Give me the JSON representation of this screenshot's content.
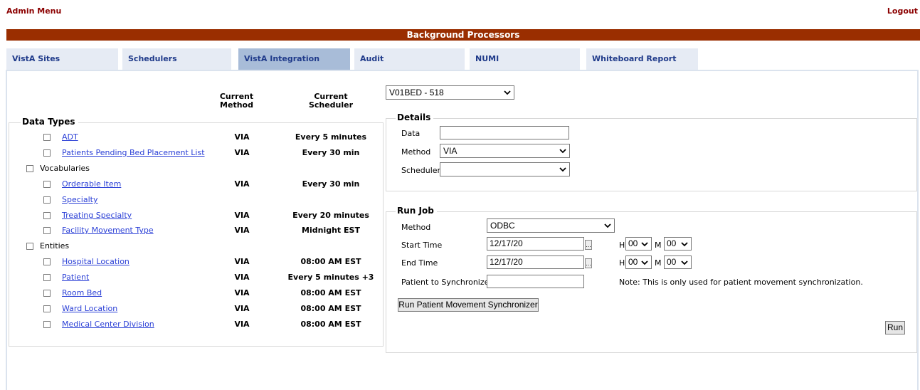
{
  "header": {
    "admin_menu": "Admin Menu",
    "logout": "Logout",
    "title": "Background Processors"
  },
  "tabs": [
    {
      "label": "VistA Sites",
      "active": false
    },
    {
      "label": "Schedulers",
      "active": false
    },
    {
      "label": "VistA Integration",
      "active": true
    },
    {
      "label": "Audit",
      "active": false
    },
    {
      "label": "NUMI",
      "active": false
    },
    {
      "label": "Whiteboard Report",
      "active": false
    }
  ],
  "left": {
    "col_method": "Current\nMethod",
    "col_scheduler": "Current\nScheduler",
    "legend": "Data Types",
    "rows": [
      {
        "label": "ADT",
        "link": true,
        "indent": true,
        "method": "VIA",
        "scheduler": "Every 5 minutes"
      },
      {
        "label": "Patients Pending Bed Placement List",
        "link": true,
        "indent": true,
        "method": "VIA",
        "scheduler": "Every 30 min"
      },
      {
        "label": "Vocabularies",
        "link": false,
        "indent": false,
        "method": "",
        "scheduler": ""
      },
      {
        "label": "Orderable Item",
        "link": true,
        "indent": true,
        "method": "VIA",
        "scheduler": "Every 30 min"
      },
      {
        "label": "Specialty",
        "link": true,
        "indent": true,
        "method": "",
        "scheduler": ""
      },
      {
        "label": "Treating Specialty",
        "link": true,
        "indent": true,
        "method": "VIA",
        "scheduler": "Every 20 minutes"
      },
      {
        "label": "Facility Movement Type",
        "link": true,
        "indent": true,
        "method": "VIA",
        "scheduler": "Midnight EST"
      },
      {
        "label": "Entities",
        "link": false,
        "indent": false,
        "method": "",
        "scheduler": ""
      },
      {
        "label": "Hospital Location",
        "link": true,
        "indent": true,
        "method": "VIA",
        "scheduler": "08:00 AM EST"
      },
      {
        "label": "Patient",
        "link": true,
        "indent": true,
        "method": "VIA",
        "scheduler": "Every 5 minutes +3"
      },
      {
        "label": "Room Bed",
        "link": true,
        "indent": true,
        "method": "VIA",
        "scheduler": "08:00 AM EST"
      },
      {
        "label": "Ward Location",
        "link": true,
        "indent": true,
        "method": "VIA",
        "scheduler": "08:00 AM EST"
      },
      {
        "label": "Medical Center Division",
        "link": true,
        "indent": true,
        "method": "VIA",
        "scheduler": "08:00 AM EST"
      }
    ]
  },
  "site_select": {
    "value": "V01BED - 518"
  },
  "details": {
    "legend": "Details",
    "data_label": "Data",
    "data_value": "",
    "method_label": "Method",
    "method_value": "VIA",
    "scheduler_label": "Scheduler",
    "scheduler_value": ""
  },
  "run_job": {
    "legend": "Run Job",
    "method_label": "Method",
    "method_value": "ODBC",
    "start_label": "Start Time",
    "start_value": "12/17/20",
    "end_label": "End Time",
    "end_value": "12/17/20",
    "h_label": "H",
    "m_label": "M",
    "start_h": "00",
    "start_m": "00",
    "end_h": "00",
    "end_m": "00",
    "patient_label": "Patient to Synchronize",
    "patient_value": "",
    "note": "Note: This is only used for patient movement synchronization.",
    "sync_button": "Run Patient Movement Synchronizer",
    "run_button": "Run",
    "picker_glyph": "..."
  },
  "icons": {
    "dropdown": "chevron-down-icon",
    "date_picker": "ellipsis-icon"
  },
  "colors": {
    "title_bar": "#9a2e00",
    "active_tab": "#a8bcd8",
    "tab": "#e6ebf4",
    "link": "#2a3fd6",
    "top_link": "#8b0000"
  }
}
